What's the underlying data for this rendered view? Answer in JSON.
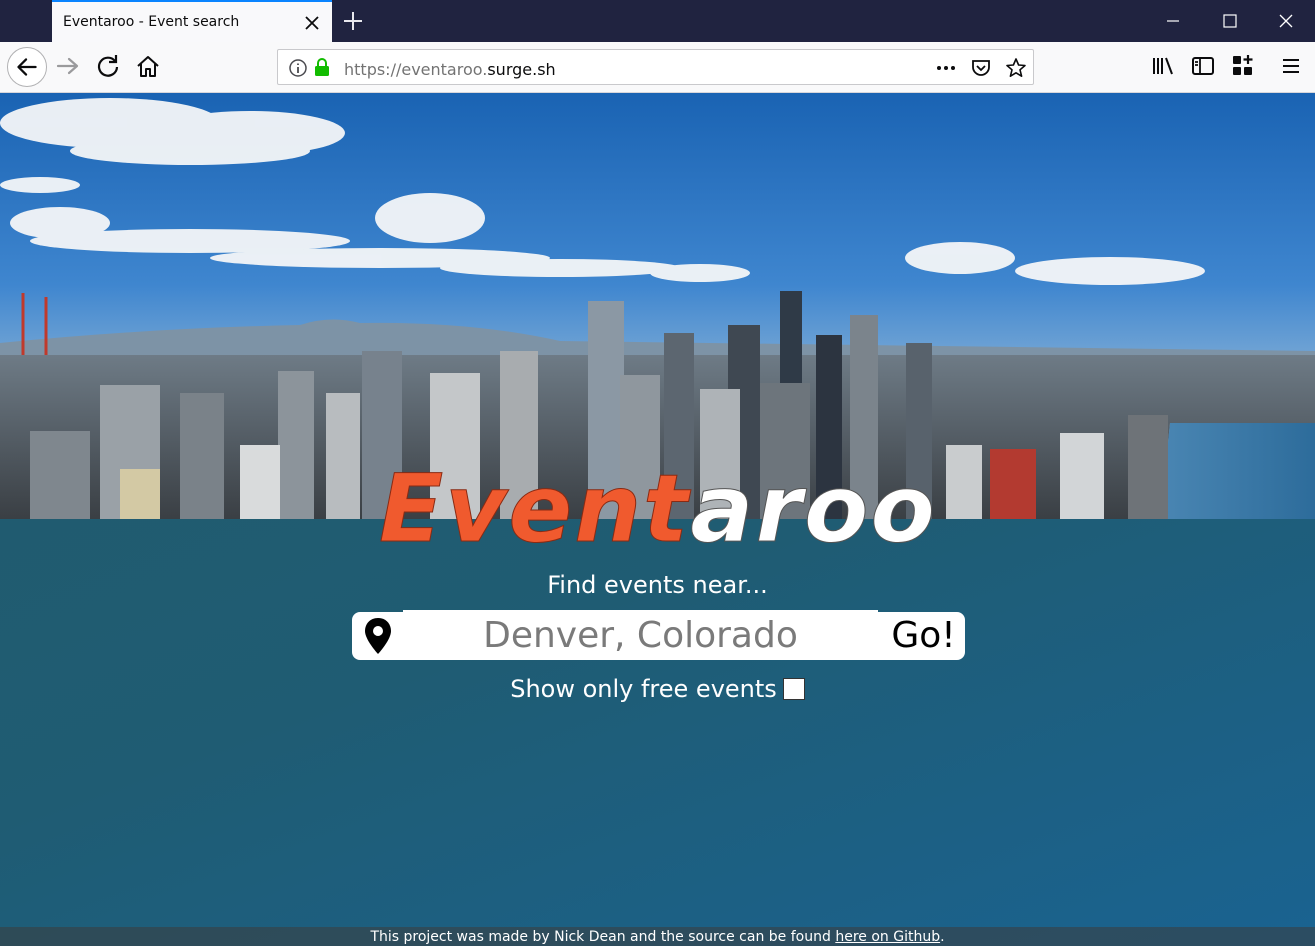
{
  "browser": {
    "tab_title": "Eventaroo - Event search",
    "url_prefix": "https://eventaroo.",
    "url_host": "surge.sh",
    "icons": [
      "close-icon",
      "plus-icon",
      "minimize-icon",
      "maximize-icon",
      "window-close-icon",
      "back-arrow-icon",
      "forward-arrow-icon",
      "reload-icon",
      "home-icon",
      "info-icon",
      "lock-icon",
      "more-icon",
      "pocket-icon",
      "star-icon",
      "library-icon",
      "sidebar-icon",
      "extensions-icon",
      "menu-icon"
    ]
  },
  "page": {
    "logo_part1": "Event",
    "logo_part2": "aroo",
    "tagline": "Find events near...",
    "search": {
      "placeholder": "Denver, Colorado",
      "button_label": "Go!"
    },
    "free_toggle_label": "Show only free events",
    "footer": {
      "text": "This project was made by Nick Dean and the source can be found",
      "link_text": "here on Github",
      "suffix": "."
    },
    "colors": {
      "logo_orange": "#f05a2e",
      "logo_white": "#ffffff",
      "page_bg": "#1f5f74"
    }
  }
}
